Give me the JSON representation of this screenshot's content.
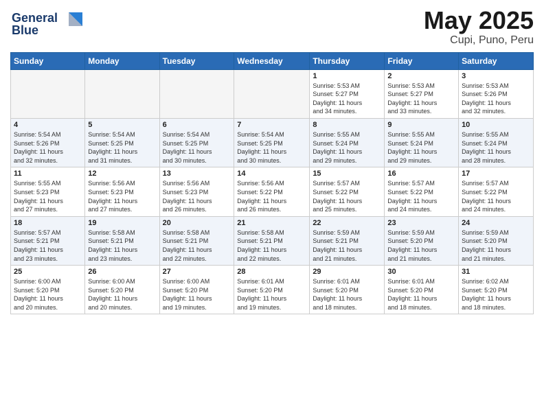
{
  "header": {
    "logo_line1": "General",
    "logo_line2": "Blue",
    "title": "May 2025",
    "location": "Cupi, Puno, Peru"
  },
  "weekdays": [
    "Sunday",
    "Monday",
    "Tuesday",
    "Wednesday",
    "Thursday",
    "Friday",
    "Saturday"
  ],
  "weeks": [
    [
      {
        "day": "",
        "info": ""
      },
      {
        "day": "",
        "info": ""
      },
      {
        "day": "",
        "info": ""
      },
      {
        "day": "",
        "info": ""
      },
      {
        "day": "1",
        "info": "Sunrise: 5:53 AM\nSunset: 5:27 PM\nDaylight: 11 hours\nand 34 minutes."
      },
      {
        "day": "2",
        "info": "Sunrise: 5:53 AM\nSunset: 5:27 PM\nDaylight: 11 hours\nand 33 minutes."
      },
      {
        "day": "3",
        "info": "Sunrise: 5:53 AM\nSunset: 5:26 PM\nDaylight: 11 hours\nand 32 minutes."
      }
    ],
    [
      {
        "day": "4",
        "info": "Sunrise: 5:54 AM\nSunset: 5:26 PM\nDaylight: 11 hours\nand 32 minutes."
      },
      {
        "day": "5",
        "info": "Sunrise: 5:54 AM\nSunset: 5:25 PM\nDaylight: 11 hours\nand 31 minutes."
      },
      {
        "day": "6",
        "info": "Sunrise: 5:54 AM\nSunset: 5:25 PM\nDaylight: 11 hours\nand 30 minutes."
      },
      {
        "day": "7",
        "info": "Sunrise: 5:54 AM\nSunset: 5:25 PM\nDaylight: 11 hours\nand 30 minutes."
      },
      {
        "day": "8",
        "info": "Sunrise: 5:55 AM\nSunset: 5:24 PM\nDaylight: 11 hours\nand 29 minutes."
      },
      {
        "day": "9",
        "info": "Sunrise: 5:55 AM\nSunset: 5:24 PM\nDaylight: 11 hours\nand 29 minutes."
      },
      {
        "day": "10",
        "info": "Sunrise: 5:55 AM\nSunset: 5:24 PM\nDaylight: 11 hours\nand 28 minutes."
      }
    ],
    [
      {
        "day": "11",
        "info": "Sunrise: 5:55 AM\nSunset: 5:23 PM\nDaylight: 11 hours\nand 27 minutes."
      },
      {
        "day": "12",
        "info": "Sunrise: 5:56 AM\nSunset: 5:23 PM\nDaylight: 11 hours\nand 27 minutes."
      },
      {
        "day": "13",
        "info": "Sunrise: 5:56 AM\nSunset: 5:23 PM\nDaylight: 11 hours\nand 26 minutes."
      },
      {
        "day": "14",
        "info": "Sunrise: 5:56 AM\nSunset: 5:22 PM\nDaylight: 11 hours\nand 26 minutes."
      },
      {
        "day": "15",
        "info": "Sunrise: 5:57 AM\nSunset: 5:22 PM\nDaylight: 11 hours\nand 25 minutes."
      },
      {
        "day": "16",
        "info": "Sunrise: 5:57 AM\nSunset: 5:22 PM\nDaylight: 11 hours\nand 24 minutes."
      },
      {
        "day": "17",
        "info": "Sunrise: 5:57 AM\nSunset: 5:22 PM\nDaylight: 11 hours\nand 24 minutes."
      }
    ],
    [
      {
        "day": "18",
        "info": "Sunrise: 5:57 AM\nSunset: 5:21 PM\nDaylight: 11 hours\nand 23 minutes."
      },
      {
        "day": "19",
        "info": "Sunrise: 5:58 AM\nSunset: 5:21 PM\nDaylight: 11 hours\nand 23 minutes."
      },
      {
        "day": "20",
        "info": "Sunrise: 5:58 AM\nSunset: 5:21 PM\nDaylight: 11 hours\nand 22 minutes."
      },
      {
        "day": "21",
        "info": "Sunrise: 5:58 AM\nSunset: 5:21 PM\nDaylight: 11 hours\nand 22 minutes."
      },
      {
        "day": "22",
        "info": "Sunrise: 5:59 AM\nSunset: 5:21 PM\nDaylight: 11 hours\nand 21 minutes."
      },
      {
        "day": "23",
        "info": "Sunrise: 5:59 AM\nSunset: 5:20 PM\nDaylight: 11 hours\nand 21 minutes."
      },
      {
        "day": "24",
        "info": "Sunrise: 5:59 AM\nSunset: 5:20 PM\nDaylight: 11 hours\nand 21 minutes."
      }
    ],
    [
      {
        "day": "25",
        "info": "Sunrise: 6:00 AM\nSunset: 5:20 PM\nDaylight: 11 hours\nand 20 minutes."
      },
      {
        "day": "26",
        "info": "Sunrise: 6:00 AM\nSunset: 5:20 PM\nDaylight: 11 hours\nand 20 minutes."
      },
      {
        "day": "27",
        "info": "Sunrise: 6:00 AM\nSunset: 5:20 PM\nDaylight: 11 hours\nand 19 minutes."
      },
      {
        "day": "28",
        "info": "Sunrise: 6:01 AM\nSunset: 5:20 PM\nDaylight: 11 hours\nand 19 minutes."
      },
      {
        "day": "29",
        "info": "Sunrise: 6:01 AM\nSunset: 5:20 PM\nDaylight: 11 hours\nand 18 minutes."
      },
      {
        "day": "30",
        "info": "Sunrise: 6:01 AM\nSunset: 5:20 PM\nDaylight: 11 hours\nand 18 minutes."
      },
      {
        "day": "31",
        "info": "Sunrise: 6:02 AM\nSunset: 5:20 PM\nDaylight: 11 hours\nand 18 minutes."
      }
    ]
  ]
}
